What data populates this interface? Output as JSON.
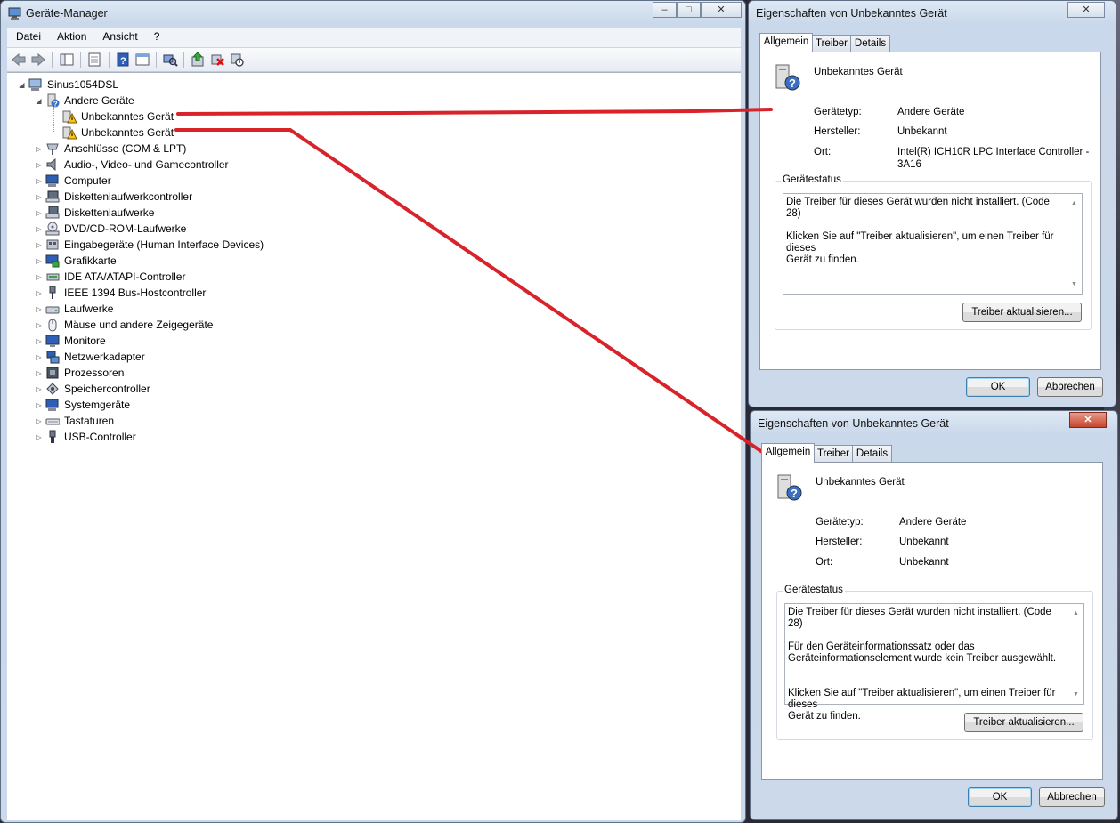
{
  "device_manager": {
    "title": "Geräte-Manager",
    "menu": [
      "Datei",
      "Aktion",
      "Ansicht",
      "?"
    ],
    "tree": {
      "root": "Sinus1054DSL",
      "group_other": "Andere Geräte",
      "unknown_1": "Unbekanntes Gerät",
      "unknown_2": "Unbekanntes Gerät",
      "categories": [
        "Anschlüsse (COM & LPT)",
        "Audio-, Video- und Gamecontroller",
        "Computer",
        "Diskettenlaufwerkcontroller",
        "Diskettenlaufwerke",
        "DVD/CD-ROM-Laufwerke",
        "Eingabegeräte (Human Interface Devices)",
        "Grafikkarte",
        "IDE ATA/ATAPI-Controller",
        "IEEE 1394 Bus-Hostcontroller",
        "Laufwerke",
        "Mäuse und andere Zeigegeräte",
        "Monitore",
        "Netzwerkadapter",
        "Prozessoren",
        "Speichercontroller",
        "Systemgeräte",
        "Tastaturen",
        "USB-Controller"
      ]
    }
  },
  "dialog1": {
    "title": "Eigenschaften von Unbekanntes Gerät",
    "tabs": [
      "Allgemein",
      "Treiber",
      "Details"
    ],
    "device_name": "Unbekanntes Gerät",
    "type_label": "Gerätetyp:",
    "type_value": "Andere Geräte",
    "manufacturer_label": "Hersteller:",
    "manufacturer_value": "Unbekannt",
    "location_label": "Ort:",
    "location_value_line1": "Intel(R) ICH10R LPC Interface Controller -",
    "location_value_line2": "3A16",
    "status_group": "Gerätestatus",
    "status_line1": "Die Treiber für dieses Gerät wurden nicht installiert. (Code 28)",
    "status_line2": "Klicken Sie auf \"Treiber aktualisieren\", um einen Treiber für dieses",
    "status_line3": "Gerät zu finden.",
    "update_button": "Treiber aktualisieren...",
    "ok_button": "OK",
    "cancel_button": "Abbrechen"
  },
  "dialog2": {
    "title": "Eigenschaften von Unbekanntes Gerät",
    "tabs": [
      "Allgemein",
      "Treiber",
      "Details"
    ],
    "device_name": "Unbekanntes Gerät",
    "type_label": "Gerätetyp:",
    "type_value": "Andere Geräte",
    "manufacturer_label": "Hersteller:",
    "manufacturer_value": "Unbekannt",
    "location_label": "Ort:",
    "location_value": "Unbekannt",
    "status_group": "Gerätestatus",
    "status_line1": "Die Treiber für dieses Gerät wurden nicht installiert. (Code 28)",
    "status_line2": "Für den Geräteinformationssatz oder das",
    "status_line3": "Geräteinformationselement wurde kein Treiber ausgewählt.",
    "status_line4": "Klicken Sie auf \"Treiber aktualisieren\", um einen Treiber für dieses",
    "status_line5": "Gerät zu finden.",
    "update_button": "Treiber aktualisieren...",
    "ok_button": "OK",
    "cancel_button": "Abbrechen"
  },
  "colors": {
    "annotation_line": "#d8232a",
    "window_frame": "#c9d8ea",
    "warning_yellow": "#f5c518"
  },
  "icons": {
    "title_icon": "device-manager-icon",
    "unknown_device": "unknown-device-warning-icon",
    "properties_device": "unknown-device-question-icon"
  }
}
